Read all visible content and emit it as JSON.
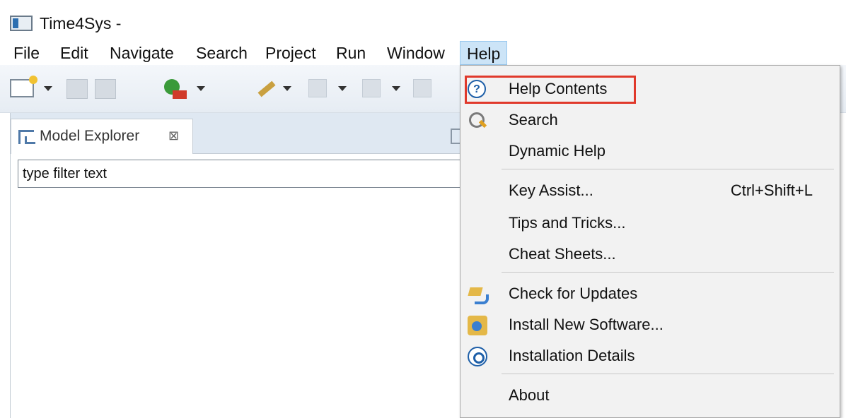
{
  "window": {
    "title": "Time4Sys -"
  },
  "menubar": {
    "items": [
      "File",
      "Edit",
      "Navigate",
      "Search",
      "Project",
      "Run",
      "Window",
      "Help"
    ],
    "active": "Help"
  },
  "view": {
    "tab_label": "Model Explorer",
    "close_glyph": "⊠",
    "filter_value": "type filter text"
  },
  "help_menu": {
    "items": [
      {
        "label": "Help Contents",
        "icon": "help-icon"
      },
      {
        "label": "Search",
        "icon": "search-icon"
      },
      {
        "label": "Dynamic Help",
        "icon": ""
      },
      {
        "label": "Key Assist...",
        "accel": "Ctrl+Shift+L"
      },
      {
        "label": "Tips and Tricks..."
      },
      {
        "label": "Cheat Sheets..."
      },
      {
        "label": "Check for Updates",
        "icon": "update-icon"
      },
      {
        "label": "Install New Software...",
        "icon": "install-icon"
      },
      {
        "label": "Installation Details",
        "icon": "details-icon"
      },
      {
        "label": "About"
      }
    ],
    "highlight_color": "#e0392b"
  },
  "colors": {
    "menu_active_bg": "#cce4f7",
    "toolbar_bg": "#e6ecf3",
    "view_header_bg": "#dfe8f2"
  }
}
